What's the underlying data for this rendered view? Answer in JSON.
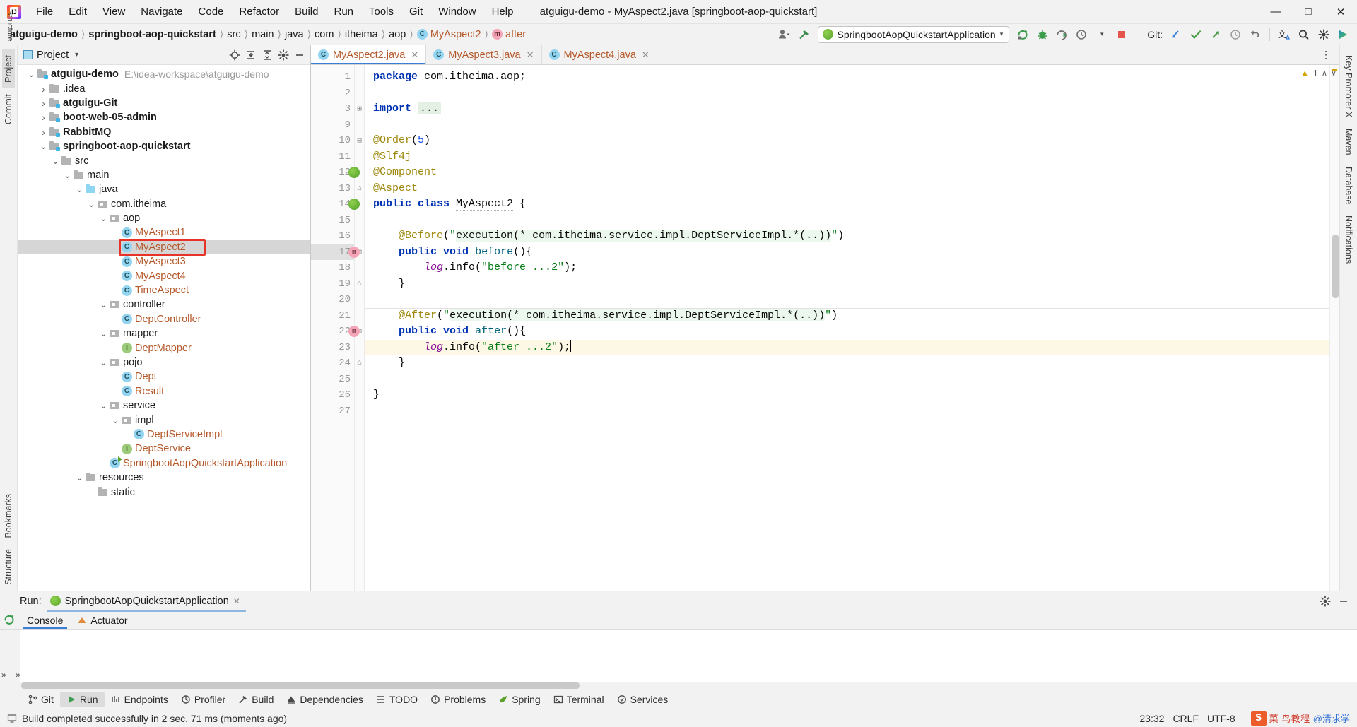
{
  "window": {
    "title": "atguigu-demo - MyAspect2.java [springboot-aop-quickstart]",
    "minimize": "–",
    "maximize": "❐",
    "close": "✕"
  },
  "menu": [
    {
      "label": "File"
    },
    {
      "label": "Edit"
    },
    {
      "label": "View"
    },
    {
      "label": "Navigate"
    },
    {
      "label": "Code"
    },
    {
      "label": "Refactor"
    },
    {
      "label": "Build"
    },
    {
      "label": "Run"
    },
    {
      "label": "Tools"
    },
    {
      "label": "Git"
    },
    {
      "label": "Window"
    },
    {
      "label": "Help"
    }
  ],
  "navbar": {
    "crumbs": [
      {
        "label": "atguigu-demo",
        "bold": true,
        "icon": "none"
      },
      {
        "label": "springboot-aop-quickstart",
        "bold": true,
        "icon": "none"
      },
      {
        "label": "src",
        "bold": false,
        "icon": "none"
      },
      {
        "label": "main",
        "bold": false,
        "icon": "none"
      },
      {
        "label": "java",
        "bold": false,
        "icon": "none"
      },
      {
        "label": "com",
        "bold": false,
        "icon": "none"
      },
      {
        "label": "itheima",
        "bold": false,
        "icon": "none"
      },
      {
        "label": "aop",
        "bold": false,
        "icon": "none"
      },
      {
        "label": "MyAspect2",
        "bold": false,
        "icon": "class",
        "cls": true
      },
      {
        "label": "after",
        "bold": false,
        "icon": "method",
        "cls": true
      }
    ],
    "separator": "〉",
    "run_config": "SpringbootAopQuickstartApplication",
    "run_config_caret": "▾",
    "git_label": "Git:",
    "icons": {
      "avatar": "person-icon",
      "hammer": "build-hammer-icon",
      "rerun": "rerun-icon",
      "debug": "debug-icon",
      "run_with_coverage": "run-coverage-icon",
      "profiler": "profiler-icon",
      "stop": "stop-icon",
      "update": "git-update-icon",
      "commit": "git-commit-icon",
      "push": "git-push-icon",
      "history": "git-history-icon",
      "rollback": "git-rollback-icon",
      "translate": "translate-icon",
      "search": "search-everywhere-icon",
      "settings": "settings-gear-icon",
      "ide_features": "ide-features-trainer-icon"
    }
  },
  "left_strip": [
    {
      "label": "Project",
      "selected": true
    },
    {
      "label": "Commit",
      "selected": false
    },
    {
      "label": "Bookmarks",
      "selected": false
    },
    {
      "label": "Structure",
      "selected": false
    }
  ],
  "right_strip": [
    {
      "label": "Key Promoter X"
    },
    {
      "label": "Maven"
    },
    {
      "label": "Database"
    },
    {
      "label": "Notifications"
    }
  ],
  "project_panel": {
    "title": "Project",
    "caret": "▾",
    "actions": [
      "target-icon",
      "expand-all-icon",
      "collapse-all-icon",
      "settings-gear-icon",
      "hide-icon"
    ],
    "tree": [
      {
        "depth": 0,
        "arrow": "down",
        "icon": "module",
        "label": "atguigu-demo",
        "bold": true,
        "hint": "E:\\idea-workspace\\atguigu-demo",
        "kind": "folder"
      },
      {
        "depth": 1,
        "arrow": "right",
        "icon": "folder",
        "label": ".idea",
        "bold": false,
        "kind": "folder"
      },
      {
        "depth": 1,
        "arrow": "right",
        "icon": "module",
        "label": "atguigu-Git",
        "bold": true,
        "kind": "folder"
      },
      {
        "depth": 1,
        "arrow": "right",
        "icon": "module",
        "label": "boot-web-05-admin",
        "bold": true,
        "kind": "folder"
      },
      {
        "depth": 1,
        "arrow": "right",
        "icon": "module",
        "label": "RabbitMQ",
        "bold": true,
        "kind": "folder"
      },
      {
        "depth": 1,
        "arrow": "down",
        "icon": "module",
        "label": "springboot-aop-quickstart",
        "bold": true,
        "kind": "folder"
      },
      {
        "depth": 2,
        "arrow": "down",
        "icon": "folder",
        "label": "src",
        "bold": false,
        "kind": "folder"
      },
      {
        "depth": 3,
        "arrow": "down",
        "icon": "folder",
        "label": "main",
        "bold": false,
        "kind": "folder"
      },
      {
        "depth": 4,
        "arrow": "down",
        "icon": "srcfolder",
        "label": "java",
        "bold": false,
        "kind": "folder"
      },
      {
        "depth": 5,
        "arrow": "down",
        "icon": "pkg",
        "label": "com.itheima",
        "bold": false,
        "kind": "folder"
      },
      {
        "depth": 6,
        "arrow": "down",
        "icon": "pkg",
        "label": "aop",
        "bold": false,
        "kind": "folder"
      },
      {
        "depth": 7,
        "arrow": "none",
        "icon": "javacls",
        "label": "MyAspect1",
        "bold": false,
        "kind": "class"
      },
      {
        "depth": 7,
        "arrow": "none",
        "icon": "javacls",
        "label": "MyAspect2",
        "bold": false,
        "kind": "class",
        "selected": true,
        "highlight": true
      },
      {
        "depth": 7,
        "arrow": "none",
        "icon": "javacls",
        "label": "MyAspect3",
        "bold": false,
        "kind": "class"
      },
      {
        "depth": 7,
        "arrow": "none",
        "icon": "javacls",
        "label": "MyAspect4",
        "bold": false,
        "kind": "class"
      },
      {
        "depth": 7,
        "arrow": "none",
        "icon": "javacls",
        "label": "TimeAspect",
        "bold": false,
        "kind": "class"
      },
      {
        "depth": 6,
        "arrow": "down",
        "icon": "pkg",
        "label": "controller",
        "bold": false,
        "kind": "folder"
      },
      {
        "depth": 7,
        "arrow": "none",
        "icon": "javacls",
        "label": "DeptController",
        "bold": false,
        "kind": "class"
      },
      {
        "depth": 6,
        "arrow": "down",
        "icon": "pkg",
        "label": "mapper",
        "bold": false,
        "kind": "folder"
      },
      {
        "depth": 7,
        "arrow": "none",
        "icon": "javaiface",
        "label": "DeptMapper",
        "bold": false,
        "kind": "class"
      },
      {
        "depth": 6,
        "arrow": "down",
        "icon": "pkg",
        "label": "pojo",
        "bold": false,
        "kind": "folder"
      },
      {
        "depth": 7,
        "arrow": "none",
        "icon": "javacls",
        "label": "Dept",
        "bold": false,
        "kind": "class"
      },
      {
        "depth": 7,
        "arrow": "none",
        "icon": "javacls",
        "label": "Result",
        "bold": false,
        "kind": "class"
      },
      {
        "depth": 6,
        "arrow": "down",
        "icon": "pkg",
        "label": "service",
        "bold": false,
        "kind": "folder"
      },
      {
        "depth": 7,
        "arrow": "down",
        "icon": "pkg",
        "label": "impl",
        "bold": false,
        "kind": "folder"
      },
      {
        "depth": 8,
        "arrow": "none",
        "icon": "javacls",
        "label": "DeptServiceImpl",
        "bold": false,
        "kind": "class"
      },
      {
        "depth": 7,
        "arrow": "none",
        "icon": "javaiface",
        "label": "DeptService",
        "bold": false,
        "kind": "class"
      },
      {
        "depth": 6,
        "arrow": "none",
        "icon": "springapp",
        "label": "SpringbootAopQuickstartApplication",
        "bold": false,
        "kind": "class"
      },
      {
        "depth": 4,
        "arrow": "down",
        "icon": "folder",
        "label": "resources",
        "bold": false,
        "kind": "folder"
      },
      {
        "depth": 5,
        "arrow": "none",
        "icon": "folder",
        "label": "static",
        "bold": false,
        "kind": "folder"
      }
    ]
  },
  "editor": {
    "tabs": [
      {
        "label": "MyAspect2.java",
        "active": true,
        "close": "✕"
      },
      {
        "label": "MyAspect3.java",
        "active": false,
        "close": "✕"
      },
      {
        "label": "MyAspect4.java",
        "active": false,
        "close": "✕"
      }
    ],
    "warning_count": "1",
    "warning_icon": "warning-triangle-icon",
    "caret_up": "∧",
    "caret_down": "∨",
    "lines": [
      {
        "num": "1",
        "text": "package com.itheima.aop;"
      },
      {
        "num": "2",
        "text": ""
      },
      {
        "num": "3",
        "text": "import ..."
      },
      {
        "num": "9",
        "text": ""
      },
      {
        "num": "10",
        "text": "@Order(5)"
      },
      {
        "num": "11",
        "text": "@Slf4j"
      },
      {
        "num": "12",
        "text": "@Component"
      },
      {
        "num": "13",
        "text": "@Aspect"
      },
      {
        "num": "14",
        "text": "public class MyAspect2 {"
      },
      {
        "num": "15",
        "text": ""
      },
      {
        "num": "16",
        "text": "    @Before(\"execution(* com.itheima.service.impl.DeptServiceImpl.*(..))\")"
      },
      {
        "num": "17",
        "text": "    public void before(){"
      },
      {
        "num": "18",
        "text": "        log.info(\"before ...2\");"
      },
      {
        "num": "19",
        "text": "    }"
      },
      {
        "num": "20",
        "text": ""
      },
      {
        "num": "21",
        "text": "    @After(\"execution(* com.itheima.service.impl.DeptServiceImpl.*(..))\")"
      },
      {
        "num": "22",
        "text": "    public void after(){"
      },
      {
        "num": "23",
        "text": "        log.info(\"after ...2\");"
      },
      {
        "num": "24",
        "text": "    }"
      },
      {
        "num": "25",
        "text": ""
      },
      {
        "num": "26",
        "text": "}"
      },
      {
        "num": "27",
        "text": ""
      }
    ],
    "current_line": "23"
  },
  "run_panel": {
    "label": "Run:",
    "config_name": "SpringbootAopQuickstartApplication",
    "close": "✕",
    "tabs": [
      {
        "label": "Console",
        "selected": true,
        "icon": "console-icon"
      },
      {
        "label": "Actuator",
        "selected": false,
        "icon": "actuator-icon"
      }
    ],
    "settings_icon": "settings-gear-icon",
    "hide_icon": "hide-icon",
    "rerun_icon": "rerun-icon",
    "expand_left": "»",
    "expand_left2": "»"
  },
  "tool_window_bar": [
    {
      "label": "Git",
      "icon": "git-branch-icon",
      "selected": false
    },
    {
      "label": "Run",
      "icon": "run-play-icon",
      "selected": true
    },
    {
      "label": "Endpoints",
      "icon": "endpoints-icon",
      "selected": false
    },
    {
      "label": "Profiler",
      "icon": "profiler-icon",
      "selected": false
    },
    {
      "label": "Build",
      "icon": "build-hammer-icon",
      "selected": false
    },
    {
      "label": "Dependencies",
      "icon": "dependencies-icon",
      "selected": false
    },
    {
      "label": "TODO",
      "icon": "todo-list-icon",
      "selected": false
    },
    {
      "label": "Problems",
      "icon": "problems-icon",
      "selected": false
    },
    {
      "label": "Spring",
      "icon": "spring-leaf-icon",
      "selected": false
    },
    {
      "label": "Terminal",
      "icon": "terminal-icon",
      "selected": false
    },
    {
      "label": "Services",
      "icon": "services-icon",
      "selected": false
    }
  ],
  "statusbar": {
    "message": "Build completed successfully in 2 sec, 71 ms (moments ago)",
    "message_icon": "build-status-icon",
    "position": "23:32",
    "line_separator": "CRLF",
    "encoding": "UTF-8",
    "watermark_logo": "S",
    "watermark_text": "菜 鸟教程",
    "watermark_sub": "@清求学"
  },
  "colors": {
    "accent": "#3a7fd5",
    "keyword": "#0033b3",
    "string": "#067d17",
    "annotation": "#9e880d",
    "class_name": "#b4582a",
    "highlight_box": "#e8332a",
    "selection": "#d6d6d6"
  }
}
